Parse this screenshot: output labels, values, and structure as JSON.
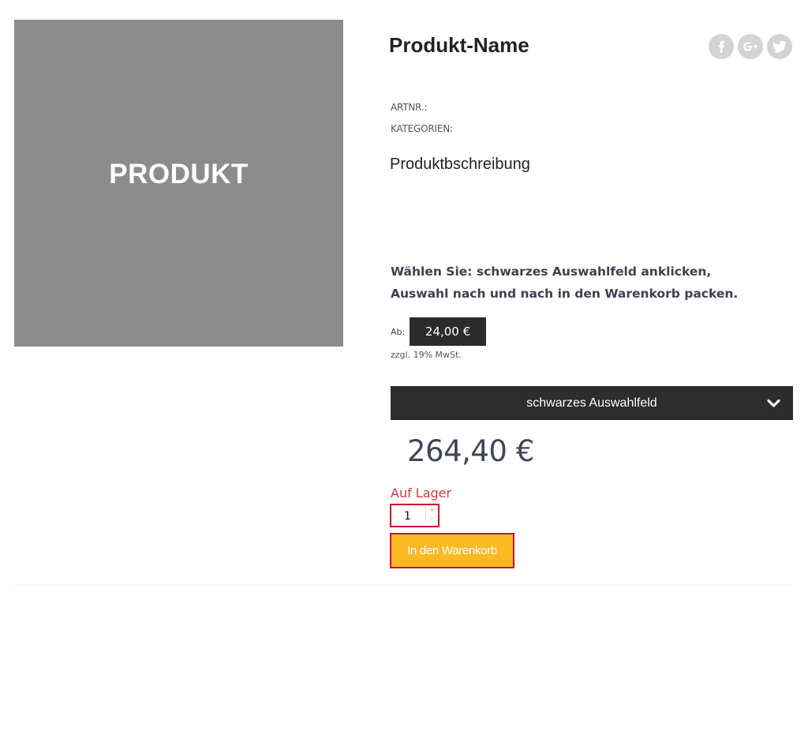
{
  "product": {
    "image_label": "PRODUKT",
    "name": "Produkt-Name",
    "artnr_label": "ARTNR.:",
    "categories_label": "KATEGORIEN:",
    "description": "Produktbschreibung"
  },
  "social": {
    "icons": [
      "facebook-icon",
      "google-plus-icon",
      "twitter-icon"
    ],
    "color": "#d4d4d4"
  },
  "instructions": {
    "line1": "Wählen Sie: schwarzes Auswahlfeld anklicken,",
    "line2": "Auswahl nach und nach in den Warenkorb packen."
  },
  "pricing": {
    "from_label": "Ab:",
    "from_price": "24,00 €",
    "vat_note": "zzgl. 19% MwSt.",
    "total": "264,40 €"
  },
  "options": {
    "select_label": "schwarzes Auswahlfeld"
  },
  "stock": {
    "status": "Auf Lager"
  },
  "quantity": {
    "value": "1",
    "increment": "+",
    "decrement": "-"
  },
  "cart": {
    "button_label": "In den Warenkorb"
  },
  "colors": {
    "image_placeholder": "#8c8c8c",
    "dark": "#2d2d2d",
    "stock_red": "#d03a3a",
    "highlight_border": "#c8102e",
    "cart_button": "#fbb923"
  }
}
